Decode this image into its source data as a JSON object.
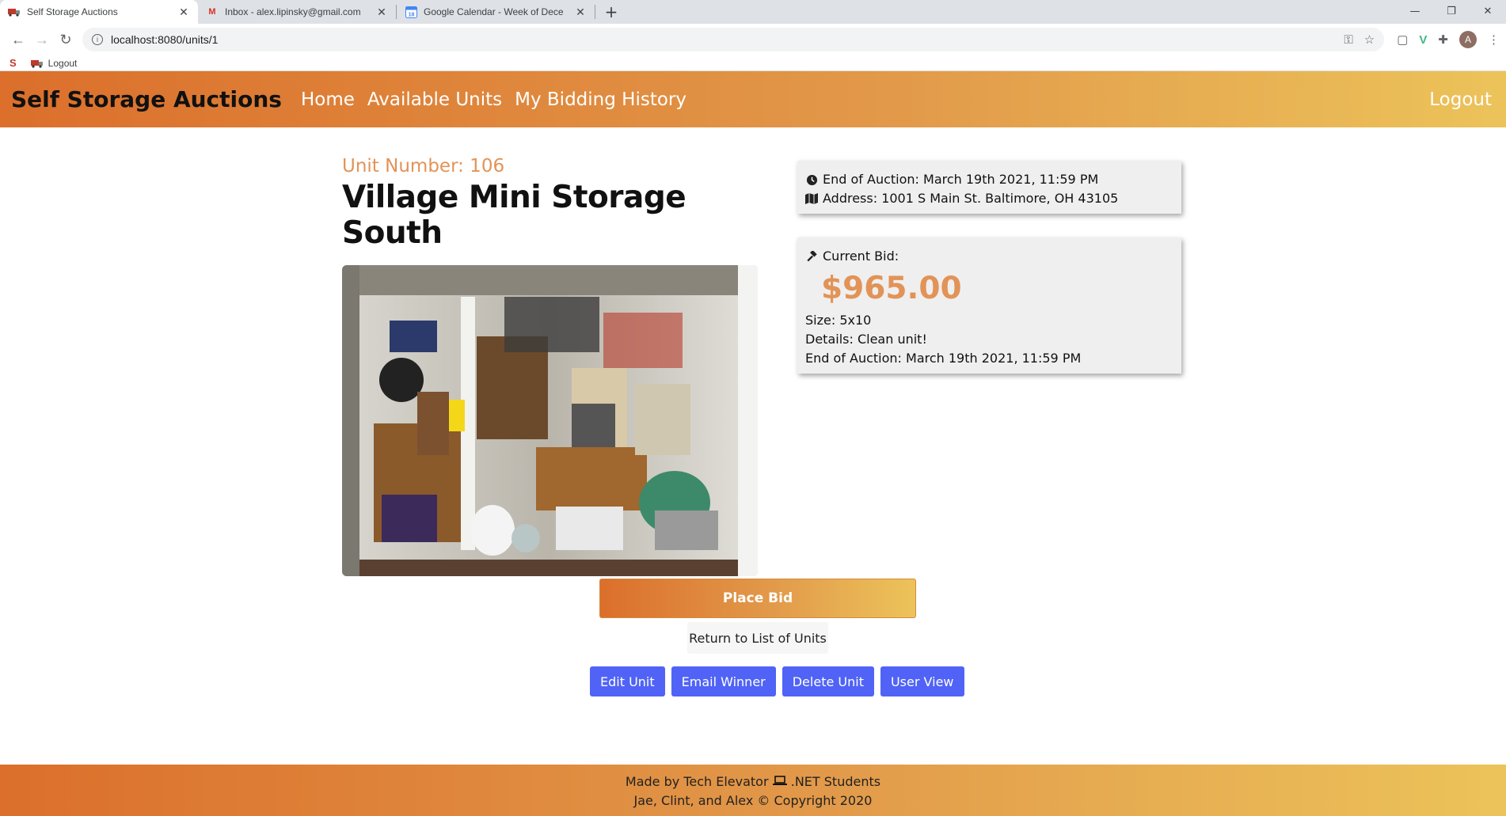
{
  "browser": {
    "tabs": [
      {
        "title": "Self Storage Auctions",
        "active": true,
        "icon": "truck-icon"
      },
      {
        "title": "Inbox - alex.lipinsky@gmail.com",
        "active": false,
        "icon": "gmail-icon"
      },
      {
        "title": "Google Calendar - Week of Dece",
        "active": false,
        "icon": "calendar-icon"
      }
    ],
    "url": "localhost:8080/units/1",
    "bookmarks": {
      "item_label": "Logout"
    },
    "avatar_letter": "A"
  },
  "nav": {
    "brand": "Self Storage Auctions",
    "links": [
      "Home",
      "Available Units",
      "My Bidding History"
    ],
    "logout": "Logout"
  },
  "unit": {
    "number_label": "Unit Number: 106",
    "name": "Village Mini Storage South"
  },
  "info_card": {
    "end_of_auction": "End of Auction: March 19th 2021, 11:59 PM",
    "address": "Address: 1001 S Main St. Baltimore, OH 43105"
  },
  "bid_card": {
    "label": "Current Bid:",
    "amount": "$965.00",
    "size": "Size: 5x10",
    "details": "Details: Clean unit!",
    "end_of_auction": "End of Auction: March 19th 2021, 11:59 PM"
  },
  "actions": {
    "place_bid": "Place Bid",
    "return": "Return to List of Units",
    "edit": "Edit Unit",
    "email": "Email Winner",
    "delete": "Delete Unit",
    "user_view": "User View"
  },
  "footer": {
    "line1_a": "Made by Tech Elevator",
    "line1_b": ".NET Students",
    "line2": "Jae, Clint, and Alex © Copyright 2020"
  },
  "colors": {
    "accent_orange": "#db6f2b",
    "accent_gold": "#ecc35a",
    "unit_number": "#e29357",
    "admin_button": "#5063f6"
  }
}
